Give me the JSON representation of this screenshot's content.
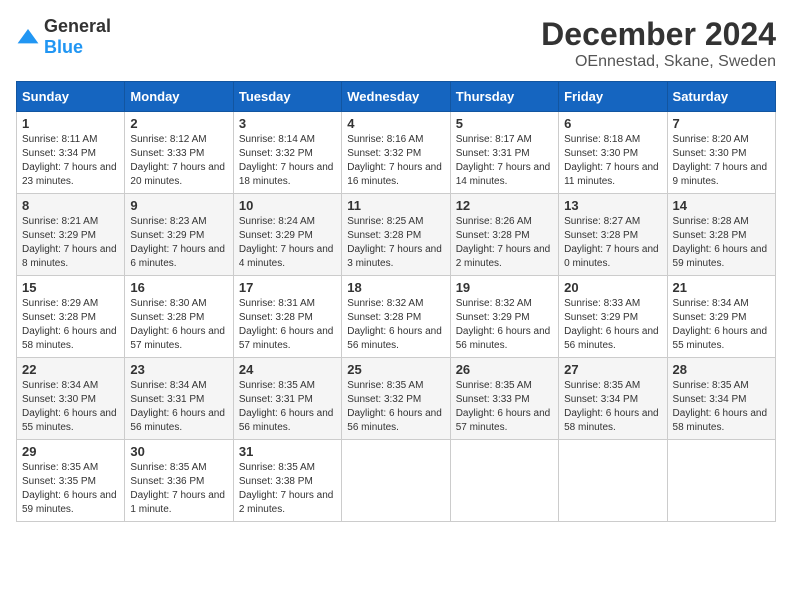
{
  "header": {
    "logo_general": "General",
    "logo_blue": "Blue",
    "month_title": "December 2024",
    "location": "OEnnestad, Skane, Sweden"
  },
  "days_of_week": [
    "Sunday",
    "Monday",
    "Tuesday",
    "Wednesday",
    "Thursday",
    "Friday",
    "Saturday"
  ],
  "weeks": [
    [
      {
        "day": "1",
        "sunrise": "8:11 AM",
        "sunset": "3:34 PM",
        "daylight": "7 hours and 23 minutes."
      },
      {
        "day": "2",
        "sunrise": "8:12 AM",
        "sunset": "3:33 PM",
        "daylight": "7 hours and 20 minutes."
      },
      {
        "day": "3",
        "sunrise": "8:14 AM",
        "sunset": "3:32 PM",
        "daylight": "7 hours and 18 minutes."
      },
      {
        "day": "4",
        "sunrise": "8:16 AM",
        "sunset": "3:32 PM",
        "daylight": "7 hours and 16 minutes."
      },
      {
        "day": "5",
        "sunrise": "8:17 AM",
        "sunset": "3:31 PM",
        "daylight": "7 hours and 14 minutes."
      },
      {
        "day": "6",
        "sunrise": "8:18 AM",
        "sunset": "3:30 PM",
        "daylight": "7 hours and 11 minutes."
      },
      {
        "day": "7",
        "sunrise": "8:20 AM",
        "sunset": "3:30 PM",
        "daylight": "7 hours and 9 minutes."
      }
    ],
    [
      {
        "day": "8",
        "sunrise": "8:21 AM",
        "sunset": "3:29 PM",
        "daylight": "7 hours and 8 minutes."
      },
      {
        "day": "9",
        "sunrise": "8:23 AM",
        "sunset": "3:29 PM",
        "daylight": "7 hours and 6 minutes."
      },
      {
        "day": "10",
        "sunrise": "8:24 AM",
        "sunset": "3:29 PM",
        "daylight": "7 hours and 4 minutes."
      },
      {
        "day": "11",
        "sunrise": "8:25 AM",
        "sunset": "3:28 PM",
        "daylight": "7 hours and 3 minutes."
      },
      {
        "day": "12",
        "sunrise": "8:26 AM",
        "sunset": "3:28 PM",
        "daylight": "7 hours and 2 minutes."
      },
      {
        "day": "13",
        "sunrise": "8:27 AM",
        "sunset": "3:28 PM",
        "daylight": "7 hours and 0 minutes."
      },
      {
        "day": "14",
        "sunrise": "8:28 AM",
        "sunset": "3:28 PM",
        "daylight": "6 hours and 59 minutes."
      }
    ],
    [
      {
        "day": "15",
        "sunrise": "8:29 AM",
        "sunset": "3:28 PM",
        "daylight": "6 hours and 58 minutes."
      },
      {
        "day": "16",
        "sunrise": "8:30 AM",
        "sunset": "3:28 PM",
        "daylight": "6 hours and 57 minutes."
      },
      {
        "day": "17",
        "sunrise": "8:31 AM",
        "sunset": "3:28 PM",
        "daylight": "6 hours and 57 minutes."
      },
      {
        "day": "18",
        "sunrise": "8:32 AM",
        "sunset": "3:28 PM",
        "daylight": "6 hours and 56 minutes."
      },
      {
        "day": "19",
        "sunrise": "8:32 AM",
        "sunset": "3:29 PM",
        "daylight": "6 hours and 56 minutes."
      },
      {
        "day": "20",
        "sunrise": "8:33 AM",
        "sunset": "3:29 PM",
        "daylight": "6 hours and 56 minutes."
      },
      {
        "day": "21",
        "sunrise": "8:34 AM",
        "sunset": "3:29 PM",
        "daylight": "6 hours and 55 minutes."
      }
    ],
    [
      {
        "day": "22",
        "sunrise": "8:34 AM",
        "sunset": "3:30 PM",
        "daylight": "6 hours and 55 minutes."
      },
      {
        "day": "23",
        "sunrise": "8:34 AM",
        "sunset": "3:31 PM",
        "daylight": "6 hours and 56 minutes."
      },
      {
        "day": "24",
        "sunrise": "8:35 AM",
        "sunset": "3:31 PM",
        "daylight": "6 hours and 56 minutes."
      },
      {
        "day": "25",
        "sunrise": "8:35 AM",
        "sunset": "3:32 PM",
        "daylight": "6 hours and 56 minutes."
      },
      {
        "day": "26",
        "sunrise": "8:35 AM",
        "sunset": "3:33 PM",
        "daylight": "6 hours and 57 minutes."
      },
      {
        "day": "27",
        "sunrise": "8:35 AM",
        "sunset": "3:34 PM",
        "daylight": "6 hours and 58 minutes."
      },
      {
        "day": "28",
        "sunrise": "8:35 AM",
        "sunset": "3:34 PM",
        "daylight": "6 hours and 58 minutes."
      }
    ],
    [
      {
        "day": "29",
        "sunrise": "8:35 AM",
        "sunset": "3:35 PM",
        "daylight": "6 hours and 59 minutes."
      },
      {
        "day": "30",
        "sunrise": "8:35 AM",
        "sunset": "3:36 PM",
        "daylight": "7 hours and 1 minute."
      },
      {
        "day": "31",
        "sunrise": "8:35 AM",
        "sunset": "3:38 PM",
        "daylight": "7 hours and 2 minutes."
      },
      null,
      null,
      null,
      null
    ]
  ]
}
